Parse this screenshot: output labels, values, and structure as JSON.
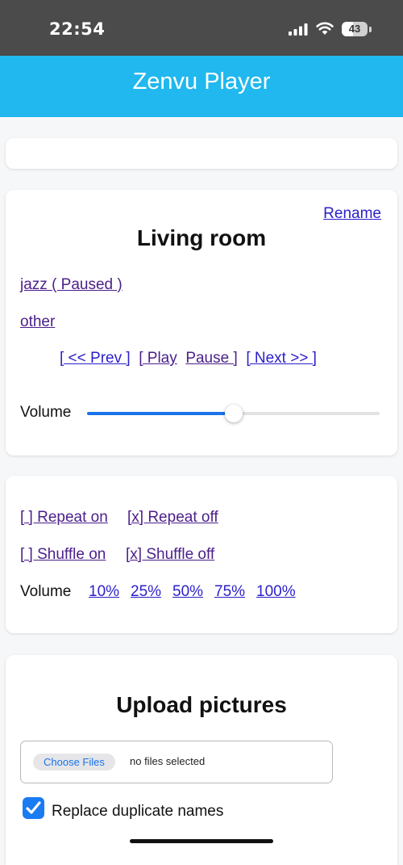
{
  "status_bar": {
    "time": "22:54",
    "battery": "43"
  },
  "header": {
    "title": "Zenvu Player"
  },
  "room": {
    "rename_label": "Rename",
    "title": "Living room",
    "playlists": [
      "jazz ( Paused )",
      "other"
    ],
    "controls": {
      "prev": "[ << Prev ]",
      "play": "[ Play",
      "pause": "Pause ]",
      "next": "[ Next >> ]"
    },
    "volume_label": "Volume",
    "volume_level": 0.5
  },
  "settings": {
    "repeat_on": "[ ] Repeat on",
    "repeat_off": "[x] Repeat off",
    "shuffle_on": "[ ] Shuffle on",
    "shuffle_off": "[x] Shuffle off",
    "volume_label": "Volume",
    "volume_presets": [
      "10%",
      "25%",
      "50%",
      "75%",
      "100%"
    ]
  },
  "upload": {
    "title": "Upload pictures",
    "choose_files": "Choose Files",
    "file_status": "no files selected",
    "replace_duplicates_label": "Replace duplicate names",
    "replace_duplicates_checked": true
  },
  "colors": {
    "header": "#20b8ee",
    "accent": "#1a73e8",
    "link": "#2b1fc9",
    "visited_link": "#4b1f8a"
  }
}
